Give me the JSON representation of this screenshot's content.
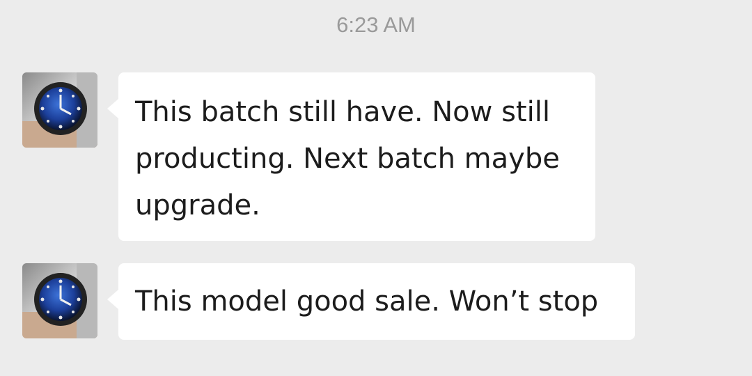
{
  "chat": {
    "timestamp": "6:23 AM",
    "messages": [
      {
        "avatar_icon": "watch-avatar-icon",
        "text": "This batch still have. Now still producting. Next batch maybe upgrade."
      },
      {
        "avatar_icon": "watch-avatar-icon",
        "text": "This model good sale. Won’t stop"
      }
    ]
  },
  "colors": {
    "background": "#ececec",
    "bubble": "#ffffff",
    "timestamp_text": "#9a9a9a",
    "message_text": "#1c1c1c"
  }
}
